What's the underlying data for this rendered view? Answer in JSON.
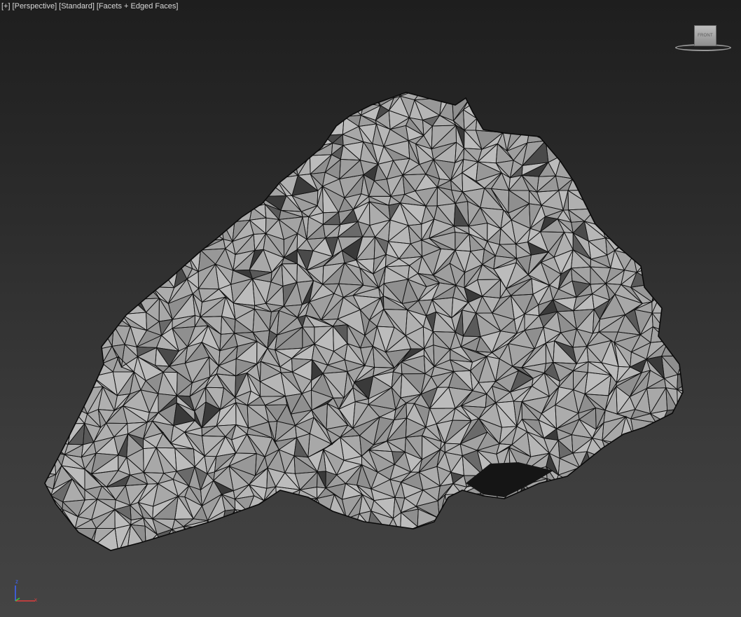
{
  "viewport": {
    "label_segments": [
      "[+]",
      "[Perspective]",
      "[Standard]",
      "[Facets + Edged Faces]"
    ]
  },
  "viewcube": {
    "face_label": "FRONT"
  },
  "axis_gizmo": {
    "z_label": "z",
    "x_label": "x",
    "z_color": "#3c64ff",
    "x_color": "#e03c3c",
    "y_color": "#3cc83c"
  },
  "scene": {
    "object": "rock-mesh",
    "shading_mode": "Facets + Edged Faces",
    "mesh_color": "#a9a9a9",
    "edge_color": "#111111",
    "background_top": "#1e1e1e",
    "background_bottom": "#444444"
  }
}
